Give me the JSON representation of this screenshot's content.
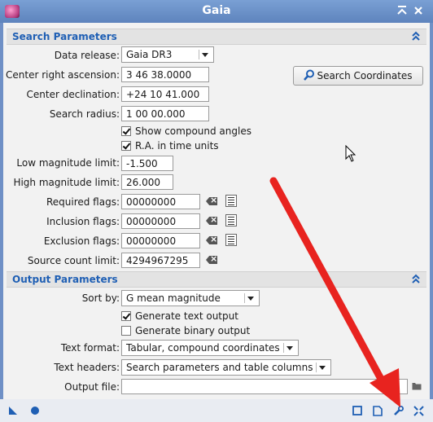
{
  "window": {
    "title": "Gaia"
  },
  "search": {
    "header": "Search Parameters",
    "data_release_label": "Data release:",
    "data_release_value": "Gaia DR3",
    "ra_label": "Center right ascension:",
    "ra_value": "3 46 38.0000",
    "dec_label": "Center declination:",
    "dec_value": "+24 10 41.000",
    "radius_label": "Search radius:",
    "radius_value": "1 00 00.000",
    "search_coords_button": "Search Coordinates",
    "show_compound_angles": "Show compound angles",
    "ra_time_units": "R.A. in time units",
    "low_mag_label": "Low magnitude limit:",
    "low_mag_value": "-1.500",
    "high_mag_label": "High magnitude limit:",
    "high_mag_value": "26.000",
    "required_flags_label": "Required flags:",
    "required_flags_value": "00000000",
    "inclusion_flags_label": "Inclusion flags:",
    "inclusion_flags_value": "00000000",
    "exclusion_flags_label": "Exclusion flags:",
    "exclusion_flags_value": "00000000",
    "source_count_label": "Source count limit:",
    "source_count_value": "4294967295"
  },
  "output": {
    "header": "Output Parameters",
    "sort_by_label": "Sort by:",
    "sort_by_value": "G mean magnitude",
    "generate_text": "Generate text output",
    "generate_binary": "Generate binary output",
    "text_format_label": "Text format:",
    "text_format_value": "Tabular, compound coordinates",
    "text_headers_label": "Text headers:",
    "text_headers_value": "Search parameters and table columns",
    "output_file_label": "Output file:",
    "output_file_value": ""
  },
  "colors": {
    "accent": "#1f5fb4",
    "arrow": "#e8231f",
    "title_bar": "#6f90c6"
  }
}
